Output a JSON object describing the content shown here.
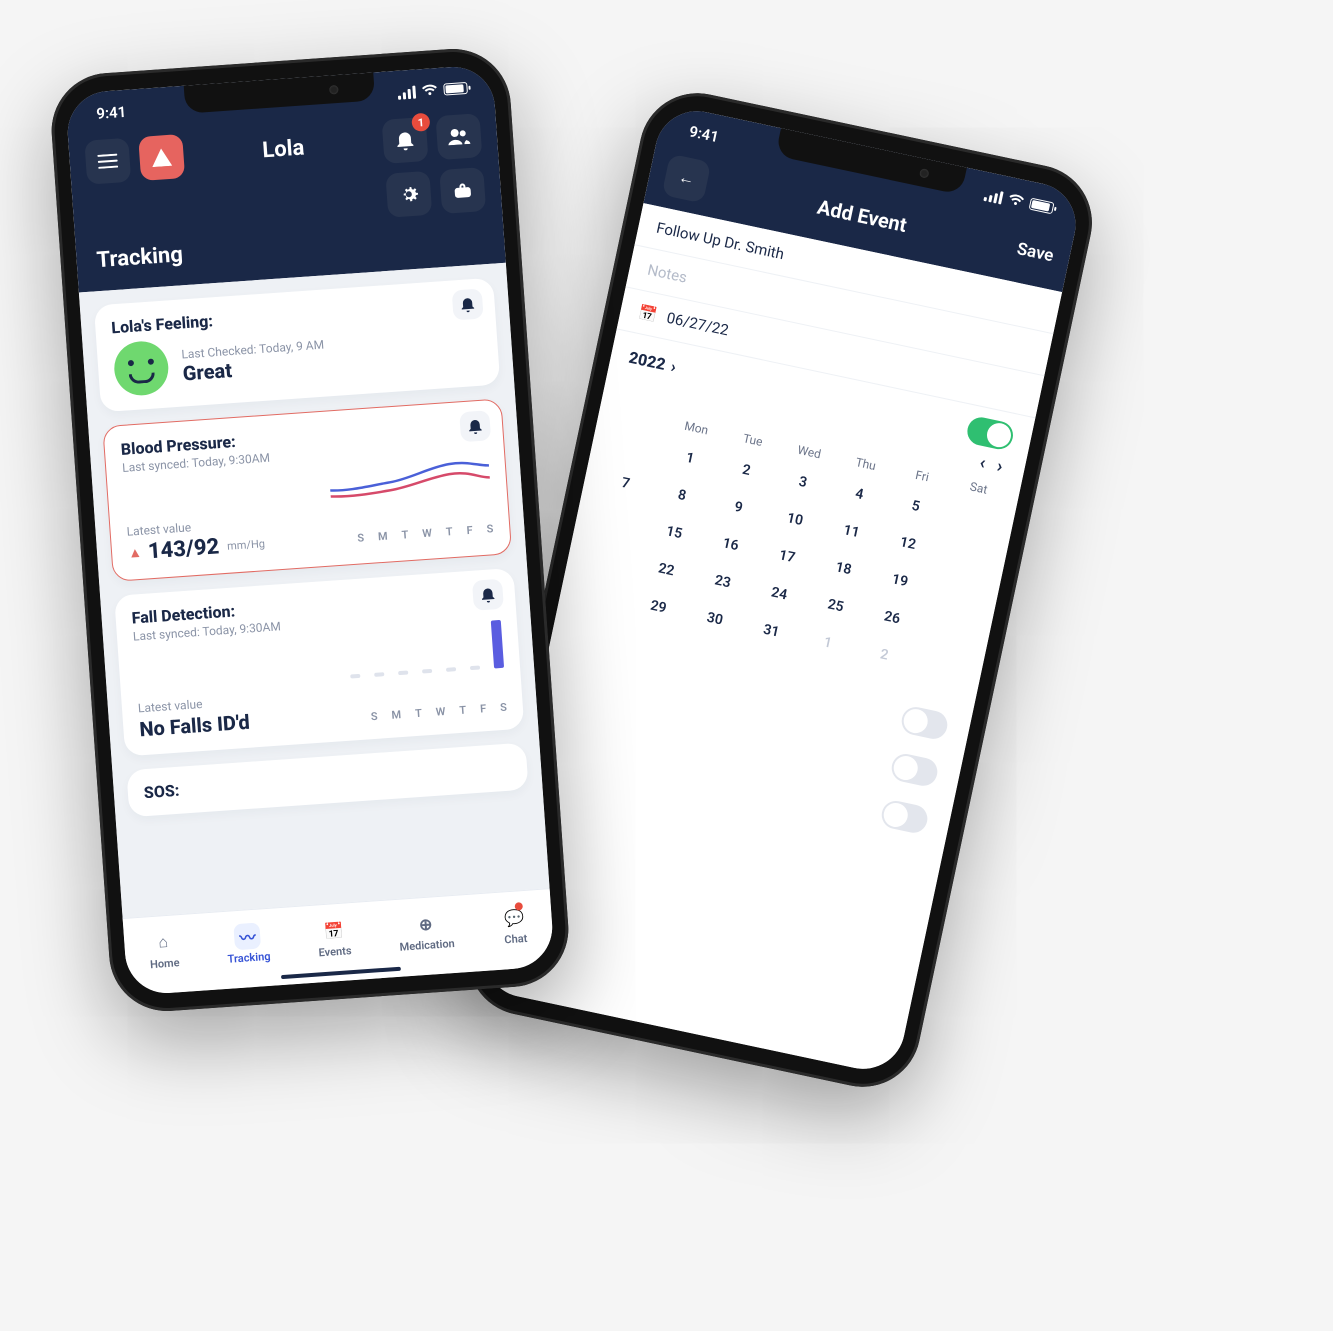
{
  "status": {
    "time": "9:41"
  },
  "left": {
    "header": {
      "title": "Lola",
      "section": "Tracking",
      "bell_badge": "1"
    },
    "feeling": {
      "title": "Lola's Feeling:",
      "last_checked": "Last Checked: Today, 9 AM",
      "value": "Great"
    },
    "bp": {
      "title": "Blood Pressure:",
      "last_synced": "Last synced: Today, 9:30AM",
      "latest_label": "Latest value",
      "value": "143/92",
      "unit": "mm/Hg"
    },
    "fall": {
      "title": "Fall Detection:",
      "last_synced": "Last synced: Today, 9:30AM",
      "latest_label": "Latest value",
      "value": "No Falls ID'd"
    },
    "sos": {
      "title": "SOS:"
    },
    "days": {
      "d0": "S",
      "d1": "M",
      "d2": "T",
      "d3": "W",
      "d4": "T",
      "d5": "F",
      "d6": "S"
    },
    "tabs": {
      "home": "Home",
      "tracking": "Tracking",
      "events": "Events",
      "medication": "Medication",
      "chat": "Chat"
    }
  },
  "right": {
    "header": {
      "title": "Add Event",
      "save": "Save"
    },
    "fields": {
      "event_title": "Follow Up Dr. Smith",
      "notes_placeholder": "Notes",
      "date": "06/27/22"
    },
    "calendar": {
      "month_label": "2022",
      "dow": {
        "mon": "Mon",
        "tue": "Tue",
        "wed": "Wed",
        "thu": "Thu",
        "fri": "Fri",
        "sat": "Sat"
      },
      "cells": {
        "r1c2": "1",
        "r1c3": "2",
        "r1c4": "3",
        "r1c5": "4",
        "r1c6": "5",
        "r2c1": "7",
        "r2c2": "8",
        "r2c3": "9",
        "r2c4": "10",
        "r2c5": "11",
        "r2c6": "12",
        "r3c2": "15",
        "r3c3": "16",
        "r3c4": "17",
        "r3c5": "18",
        "r3c6": "19",
        "r4c2": "22",
        "r4c3": "23",
        "r4c4": "24",
        "r4c5": "25",
        "r4c6": "26",
        "r5c2": "29",
        "r5c3": "30",
        "r5c4": "31",
        "r5c5": "1",
        "r5c6": "2"
      }
    }
  }
}
